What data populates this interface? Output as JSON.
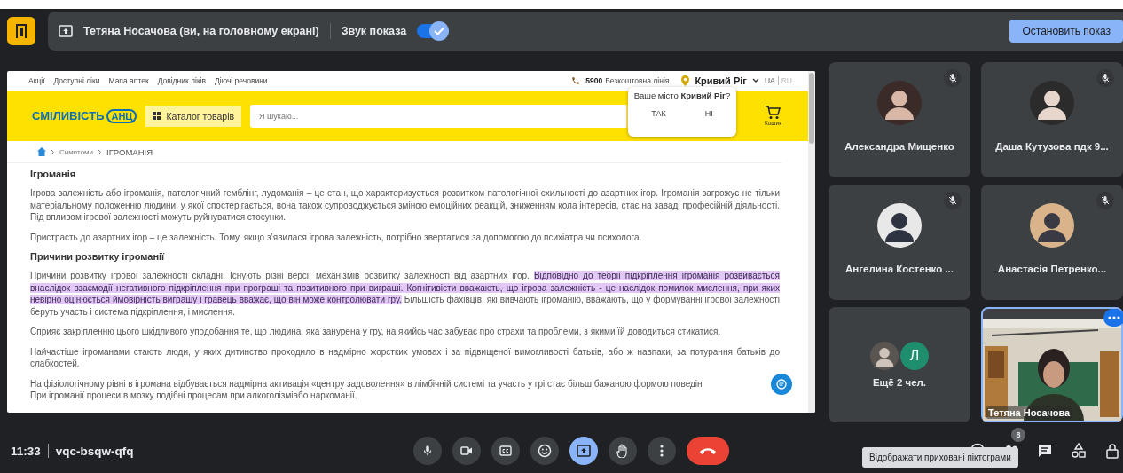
{
  "top_bar": {
    "presenter": "Тетяна Носачова (ви, на головному екрані)",
    "sound_label": "Звук показа",
    "sound_on": true,
    "stop_button": "Остановить показ"
  },
  "shared_page": {
    "nav_links": [
      "Акції",
      "Доступні ліки",
      "Мапа аптек",
      "Довідник ліків",
      "Діючі речовини"
    ],
    "phone": "5900",
    "phone_label": "Безкоштовна лінія",
    "city": "Кривий Ріг",
    "languages": [
      {
        "label": "UA",
        "selected": true
      },
      {
        "label": "RU",
        "selected": false
      }
    ],
    "logo": "СМІЛИВІСТЬ",
    "logo_badge": "АНЦ",
    "catalog_button": "Каталог товарів",
    "search_placeholder": "Я шукаю...",
    "cart_label": "Кошик",
    "city_popup": {
      "question": "Ваше місто **Кривий Ріг**?",
      "buttons": [
        "ТАК",
        "НІ"
      ]
    },
    "breadcrumb": [
      "Симптоми",
      "ІГРОМАНІЯ"
    ],
    "sections": [
      {
        "kind": "heading",
        "text": "Ігроманія"
      },
      {
        "kind": "paragraph",
        "text": "Ігрова залежність або ігроманія, патологічний гемблінг, лудоманія – це стан, що характеризується розвитком патологічної схильності до азартних ігор. Ігроманія загрожує не тільки матеріальному положенню людини, у якої спостерігається, вона також супроводжується зміною емоційних реакцій, зниженням кола інтересів, стає на заваді професійній діяльності. Під впливом ігрової залежності можуть руйнуватися стосунки."
      },
      {
        "kind": "paragraph",
        "text": "Пристрасть до азартних ігор – це залежність. Тому, якщо з’явилася ігрова залежність, потрібно звертатися за допомогою до психіатра чи психолога."
      },
      {
        "kind": "heading",
        "text": "Причини розвитку ігроманії"
      },
      {
        "kind": "paragraph",
        "text": "Причини розвитку ігрової залежності складні. Існують різні версії механізмів розвитку залежності від азартних ігор. ",
        "highlight": "Відповідно до теорії підкріплення ігроманія розвивається внаслідок взаємодії негативного підкріплення при програші та позитивного при виграші. Когнітивісти вважають, що ігрова залежність - це наслідок помилок мислення, при яких невірно оцінюється ймовірність виграшу і гравець вважає, що він може контролювати гру.",
        "after": " Більшість фахівців, які вивчають ігроманію, вважають, що у формуванні ігрової залежності беруть участь і система підкріплення, і мислення."
      },
      {
        "kind": "paragraph",
        "text": "Сприяє закріпленню цього шкідливого уподобання те, що людина, яка занурена у гру, на якийсь час забуває про страхи та проблеми, з якими їй доводиться стикатися."
      },
      {
        "kind": "paragraph",
        "text": "Найчастіше ігроманами стають люди, у яких дитинство проходило в надмірно жорстких умовах і за підвищеної вимогливості батьків, або ж навпаки, за потурання батьків до слабкостей."
      },
      {
        "kind": "lines",
        "lines": [
          "На фізіологічному рівні в ігромана відбувається надмірна активація «центру задоволення» в лімбічній системі та участь у грі стає більш бажаною формою поведін",
          "При ігроманії процеси в мозку подібні процесам при алкоголізміабо наркоманії."
        ]
      }
    ]
  },
  "participants": [
    {
      "kind": "avatar",
      "name": "Александра Мищенко",
      "muted": true
    },
    {
      "kind": "avatar",
      "name": "Даша Кутузова пдк 9...",
      "muted": true
    },
    {
      "kind": "avatar",
      "name": "Ангелина Костенко ...",
      "muted": true
    },
    {
      "kind": "avatar",
      "name": "Анастасія Петренко...",
      "muted": true
    },
    {
      "kind": "more",
      "label": "Ещё 2 чел.",
      "initial": "Л",
      "color": "#1e8e6e"
    },
    {
      "kind": "video",
      "name": "Тетяна Носачова",
      "selected": true
    }
  ],
  "bottom_bar": {
    "time": "11:33",
    "meeting_code": "vqc-bsqw-qfq",
    "presenting": true,
    "people_count": "8",
    "tooltip": "Відображати приховані піктограми"
  }
}
